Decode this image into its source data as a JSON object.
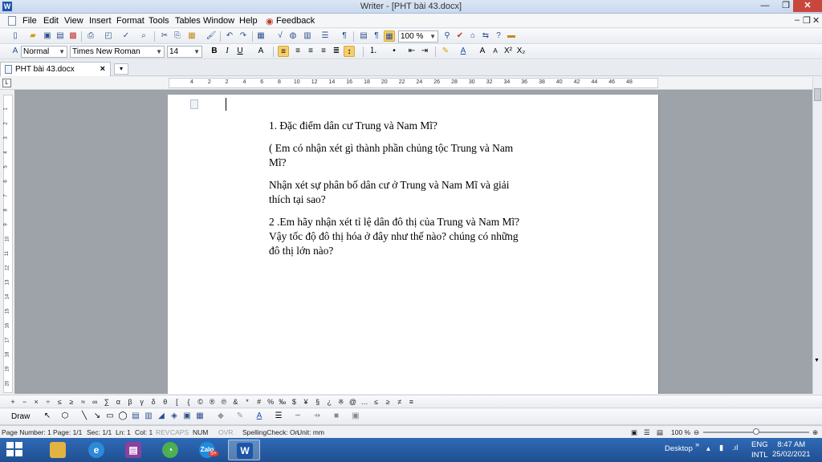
{
  "window": {
    "title": "Writer - [PHT bài 43.docx]",
    "app_icon": "W"
  },
  "menubar": {
    "items": [
      "File",
      "Edit",
      "View",
      "Insert",
      "Format",
      "Tools",
      "Tables",
      "Window",
      "Help",
      "Feedback"
    ]
  },
  "toolbar": {
    "zoom": "100 %"
  },
  "formatting": {
    "style": "Normal",
    "font": "Times New Roman",
    "size": "14"
  },
  "tab": {
    "label": "PHT bài 43.docx"
  },
  "ruler": {
    "ticks": [
      "4",
      "2",
      "2",
      "4",
      "6",
      "8",
      "10",
      "12",
      "14",
      "16",
      "18",
      "20",
      "22",
      "24",
      "26",
      "28",
      "30",
      "32",
      "34",
      "36",
      "38",
      "40",
      "42",
      "44",
      "46",
      "48"
    ]
  },
  "vruler": {
    "ticks": [
      "1",
      "2",
      "3",
      "4",
      "5",
      "6",
      "7",
      "8",
      "9",
      "10",
      "11",
      "12",
      "13",
      "14",
      "15",
      "16",
      "17",
      "18",
      "19",
      "20"
    ]
  },
  "document": {
    "paragraphs": [
      "1.  Đặc điểm dân cư Trung và Nam  Mĩ?",
      "( Em có nhận xét gì thành phần chủng tộc Trung và Nam Mĩ?",
      "Nhận xét sự phân bố dân cư ở Trung và Nam Mĩ và giải thích tại sao?",
      "2 .Em hãy nhận xét tỉ lệ dân đô thị của Trung và Nam Mĩ?  Vậy tốc độ đô thị hóa ở đây như thế nào? chúng có những đô thị lớn nào?"
    ]
  },
  "symbols": [
    "+",
    "−",
    "×",
    "÷",
    "≤",
    "≥",
    "≈",
    "∞",
    "∑",
    "α",
    "β",
    "γ",
    "δ",
    "θ",
    "[",
    "{",
    "©",
    "®",
    "℗",
    "&",
    "*",
    "#",
    "%",
    "‰",
    "$",
    "¥",
    "§",
    "¿",
    "※",
    "@",
    "…",
    "≤",
    "≥",
    "≠",
    "≡"
  ],
  "drawbar": {
    "draw_label": "Draw"
  },
  "status": {
    "page_number": "Page Number: 1",
    "page": "Page: 1/1",
    "sec": "Sec: 1/1",
    "ln": "Ln: 1",
    "col": "Col: 1",
    "rev": "REV",
    "caps": "CAPS",
    "num": "NUM",
    "ovr": "OVR",
    "spelling": "SpellingCheck: On",
    "unit": "Unit: mm",
    "zoom": "100 %"
  },
  "taskbar": {
    "desktop": "Desktop",
    "lang_top": "ENG",
    "lang_bottom": "INTL",
    "time": "8:47 AM",
    "date": "25/02/2021",
    "zalo_badge": "5+"
  },
  "colors": {
    "title_bg": "#c8d8ee",
    "taskbar": "#2a5fa8",
    "page_bg": "#9ea3a9",
    "close": "#c9463d"
  }
}
